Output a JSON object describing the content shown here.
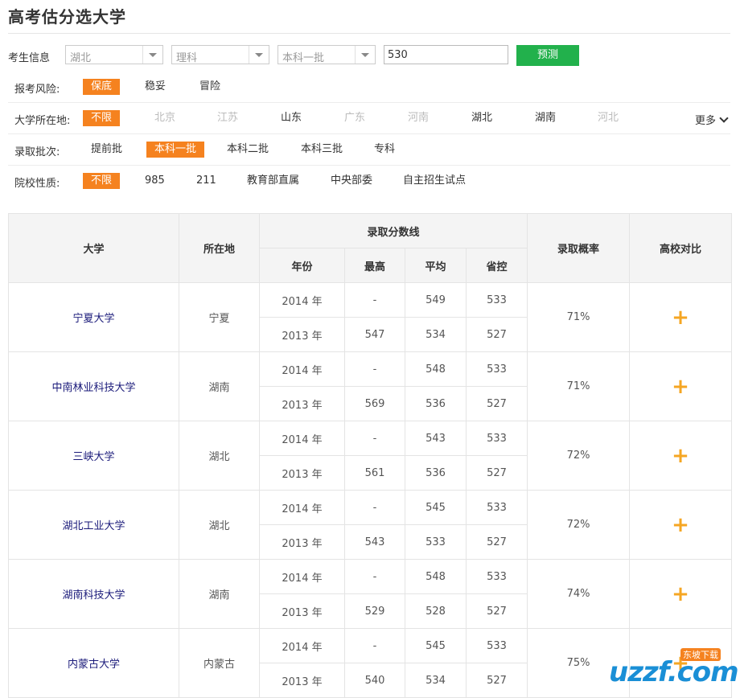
{
  "title": "高考估分选大学",
  "info": {
    "label": "考生信息",
    "province": "湖北",
    "subject": "理科",
    "batch": "本科一批",
    "score": "530",
    "predict_button": "预测"
  },
  "filters": [
    {
      "label": "报考风险:",
      "options": [
        {
          "text": "保底",
          "state": "active"
        },
        {
          "text": "稳妥",
          "state": "normal"
        },
        {
          "text": "冒险",
          "state": "normal"
        }
      ]
    },
    {
      "label": "大学所在地:",
      "more": "更多",
      "options": [
        {
          "text": "不限",
          "state": "active"
        },
        {
          "text": "北京",
          "state": "dim"
        },
        {
          "text": "江苏",
          "state": "dim"
        },
        {
          "text": "山东",
          "state": "normal"
        },
        {
          "text": "广东",
          "state": "dim"
        },
        {
          "text": "河南",
          "state": "dim"
        },
        {
          "text": "湖北",
          "state": "normal"
        },
        {
          "text": "湖南",
          "state": "normal"
        },
        {
          "text": "河北",
          "state": "dim"
        }
      ]
    },
    {
      "label": "录取批次:",
      "options": [
        {
          "text": "提前批",
          "state": "normal"
        },
        {
          "text": "本科一批",
          "state": "active"
        },
        {
          "text": "本科二批",
          "state": "normal"
        },
        {
          "text": "本科三批",
          "state": "normal"
        },
        {
          "text": "专科",
          "state": "normal"
        }
      ]
    },
    {
      "label": "院校性质:",
      "options": [
        {
          "text": "不限",
          "state": "active"
        },
        {
          "text": "985",
          "state": "normal"
        },
        {
          "text": "211",
          "state": "normal"
        },
        {
          "text": "教育部直属",
          "state": "normal"
        },
        {
          "text": "中央部委",
          "state": "normal"
        },
        {
          "text": "自主招生试点",
          "state": "normal"
        }
      ]
    }
  ],
  "table": {
    "headers": {
      "university": "大学",
      "location": "所在地",
      "score_line": "录取分数线",
      "year": "年份",
      "max": "最高",
      "avg": "平均",
      "control": "省控",
      "probability": "录取概率",
      "compare": "高校对比"
    },
    "rows": [
      {
        "name": "宁夏大学",
        "loc": "宁夏",
        "prob": "71%",
        "years": [
          {
            "year": "2014 年",
            "max": "-",
            "avg": "549",
            "ctrl": "533"
          },
          {
            "year": "2013 年",
            "max": "547",
            "avg": "534",
            "ctrl": "527"
          }
        ]
      },
      {
        "name": "中南林业科技大学",
        "loc": "湖南",
        "prob": "71%",
        "years": [
          {
            "year": "2014 年",
            "max": "-",
            "avg": "548",
            "ctrl": "533"
          },
          {
            "year": "2013 年",
            "max": "569",
            "avg": "536",
            "ctrl": "527"
          }
        ]
      },
      {
        "name": "三峡大学",
        "loc": "湖北",
        "prob": "72%",
        "years": [
          {
            "year": "2014 年",
            "max": "-",
            "avg": "543",
            "ctrl": "533"
          },
          {
            "year": "2013 年",
            "max": "561",
            "avg": "536",
            "ctrl": "527"
          }
        ]
      },
      {
        "name": "湖北工业大学",
        "loc": "湖北",
        "prob": "72%",
        "years": [
          {
            "year": "2014 年",
            "max": "-",
            "avg": "545",
            "ctrl": "533"
          },
          {
            "year": "2013 年",
            "max": "543",
            "avg": "533",
            "ctrl": "527"
          }
        ]
      },
      {
        "name": "湖南科技大学",
        "loc": "湖南",
        "prob": "74%",
        "years": [
          {
            "year": "2014 年",
            "max": "-",
            "avg": "548",
            "ctrl": "533"
          },
          {
            "year": "2013 年",
            "max": "529",
            "avg": "528",
            "ctrl": "527"
          }
        ]
      },
      {
        "name": "内蒙古大学",
        "loc": "内蒙古",
        "prob": "75%",
        "years": [
          {
            "year": "2014 年",
            "max": "-",
            "avg": "545",
            "ctrl": "533"
          },
          {
            "year": "2013 年",
            "max": "540",
            "avg": "534",
            "ctrl": "527"
          }
        ]
      }
    ],
    "compare_symbol": "+"
  },
  "watermark": {
    "text": "uzzf.com",
    "badge": "东坡下载"
  }
}
